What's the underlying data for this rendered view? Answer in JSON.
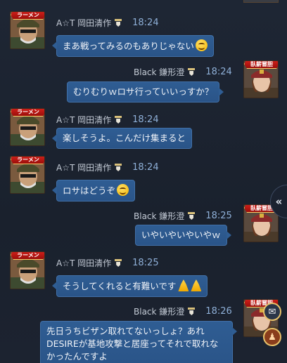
{
  "chat": {
    "badge_left": "ラーメン",
    "badge_right": "臥薪嘗胆",
    "messages": [
      {
        "side": "left",
        "header": "A☆T 岡田清作",
        "time": "18:24",
        "text": "まあ戦ってみるのもありじゃない",
        "emoji": "smile-emoji"
      },
      {
        "side": "right",
        "header": "Black 鎌形澄",
        "time": "18:24",
        "text": "むりむりｗロサ行っていいっすか？"
      },
      {
        "side": "left",
        "header": "A☆T 岡田清作",
        "time": "18:24",
        "text": "楽しそうよ。こんだけ集まると"
      },
      {
        "side": "left",
        "header": "A☆T 岡田清作",
        "time": "18:24",
        "text": "ロサはどうぞ",
        "emoji": "smile-emoji"
      },
      {
        "side": "right",
        "header": "Black 鎌形澄",
        "time": "18:25",
        "text": "いやいやいやいやｗ"
      },
      {
        "side": "left",
        "header": "A☆T 岡田清作",
        "time": "18:25",
        "text": "そうしてくれると有難いです",
        "emoji": "pray-emoji"
      },
      {
        "side": "right",
        "header": "Black 鎌形澄",
        "time": "18:26",
        "text": "先日うちビザン取れてないっしょ？あれDESIREが基地攻撃と居座ってそれで取れなかったんですよ"
      }
    ]
  },
  "colors": {
    "background": "#1e2634",
    "bubble": "#2f5d93",
    "time": "#8fb0d8",
    "badge": "#d8231c"
  },
  "icons": {
    "side_tab": "«",
    "mail": "mail-icon",
    "friend": "friend-icon"
  }
}
